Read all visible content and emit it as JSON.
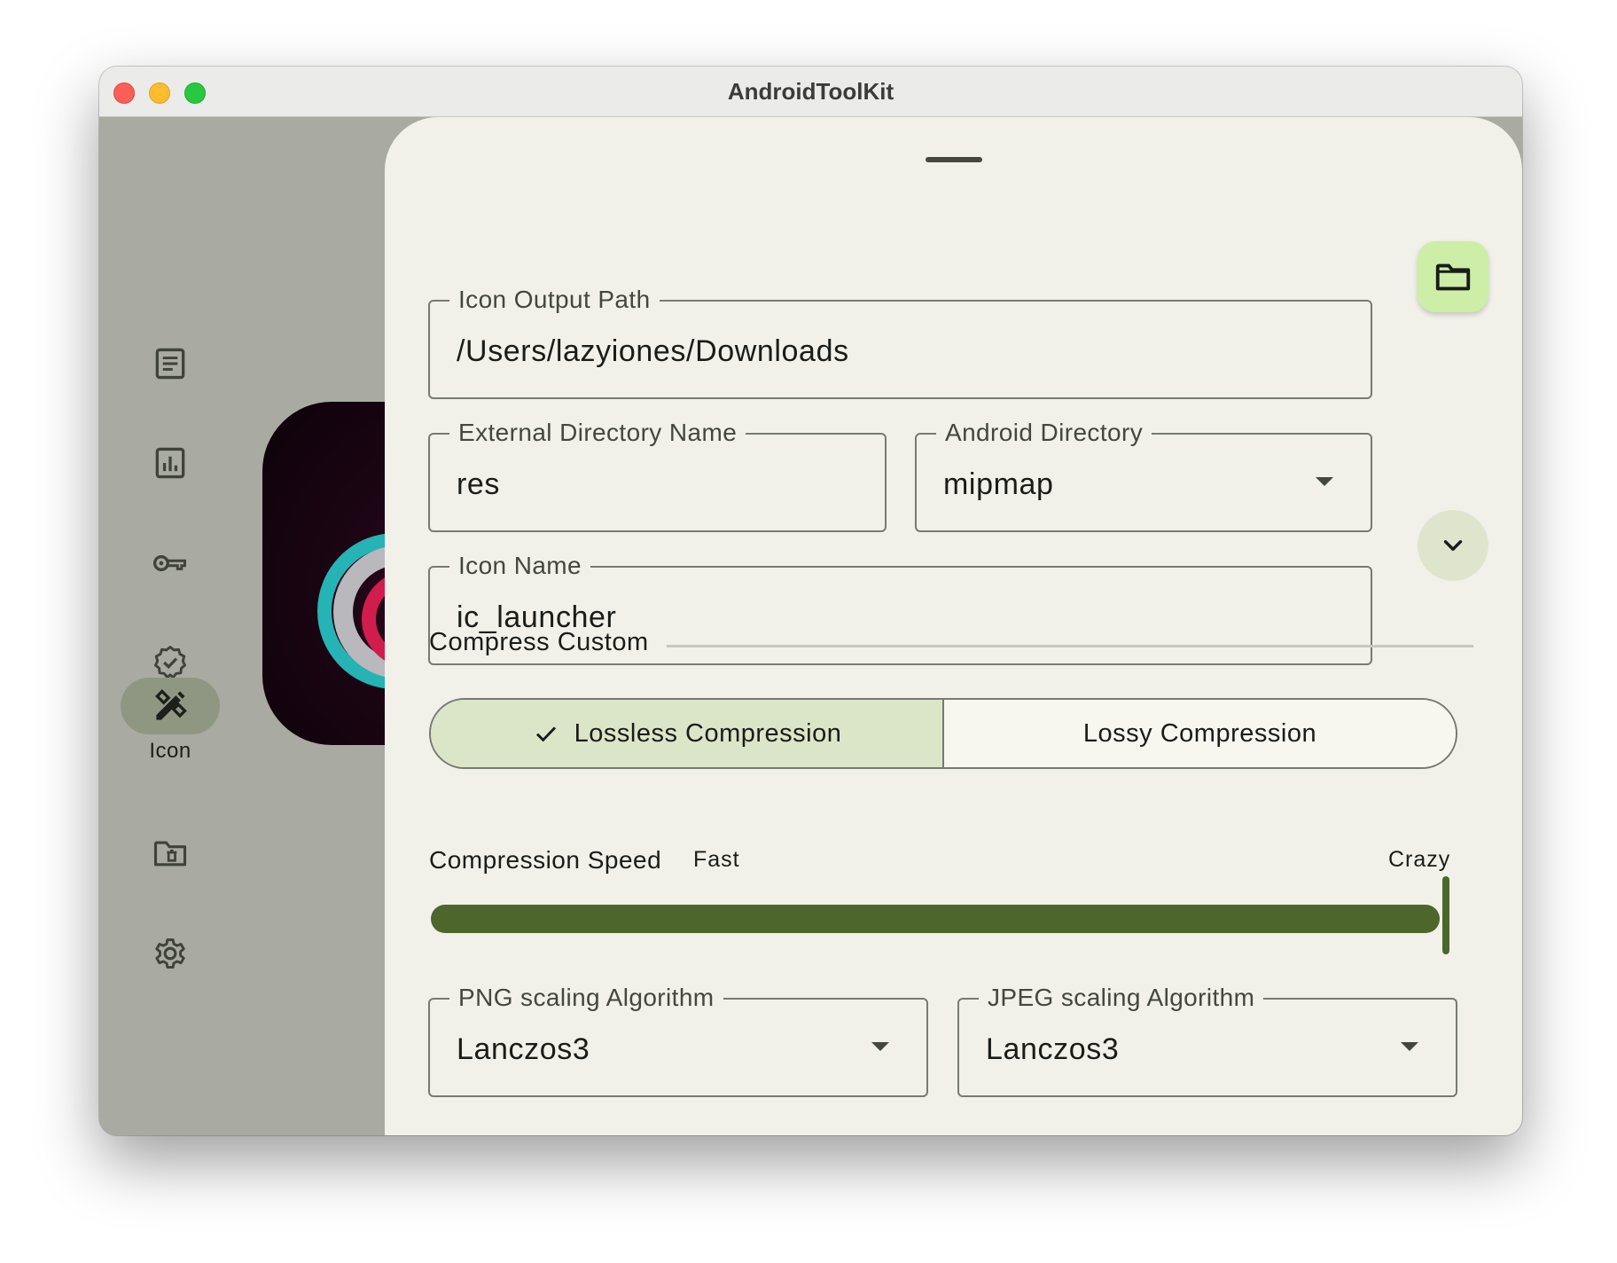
{
  "window": {
    "title": "AndroidToolKit"
  },
  "sidebar": {
    "items": [
      {
        "icon": "document-list-icon",
        "label": ""
      },
      {
        "icon": "bar-chart-icon",
        "label": ""
      },
      {
        "icon": "key-icon",
        "label": ""
      },
      {
        "icon": "verified-badge-icon",
        "label": ""
      },
      {
        "icon": "design-tools-icon",
        "label": "Icon",
        "active": true
      },
      {
        "icon": "folder-delete-icon",
        "label": ""
      },
      {
        "icon": "gear-icon",
        "label": ""
      }
    ]
  },
  "form": {
    "output_path": {
      "label": "Icon Output Path",
      "value": "/Users/lazyiones/Downloads"
    },
    "external_dir": {
      "label": "External Directory Name",
      "value": "res"
    },
    "android_dir": {
      "label": "Android Directory",
      "value": "mipmap"
    },
    "icon_name": {
      "label": "Icon Name",
      "value": "ic_launcher"
    },
    "compress_section": "Compress Custom",
    "compression_modes": {
      "lossless": "Lossless Compression",
      "lossy": "Lossy Compression",
      "selected": "lossless"
    },
    "speed": {
      "label": "Compression Speed",
      "min_label": "Fast",
      "max_label": "Crazy",
      "value_fraction": 1.0
    },
    "png_algorithm": {
      "label": "PNG scaling Algorithm",
      "value": "Lanczos3"
    },
    "jpeg_algorithm": {
      "label": "JPEG scaling Algorithm",
      "value": "Lanczos3"
    }
  },
  "colors": {
    "accent": "#4c662c",
    "selected_segment": "#dbe6c8",
    "fab": "#cdeea7",
    "sheet": "#f1f1e9",
    "rail_active": "#8f9783"
  }
}
